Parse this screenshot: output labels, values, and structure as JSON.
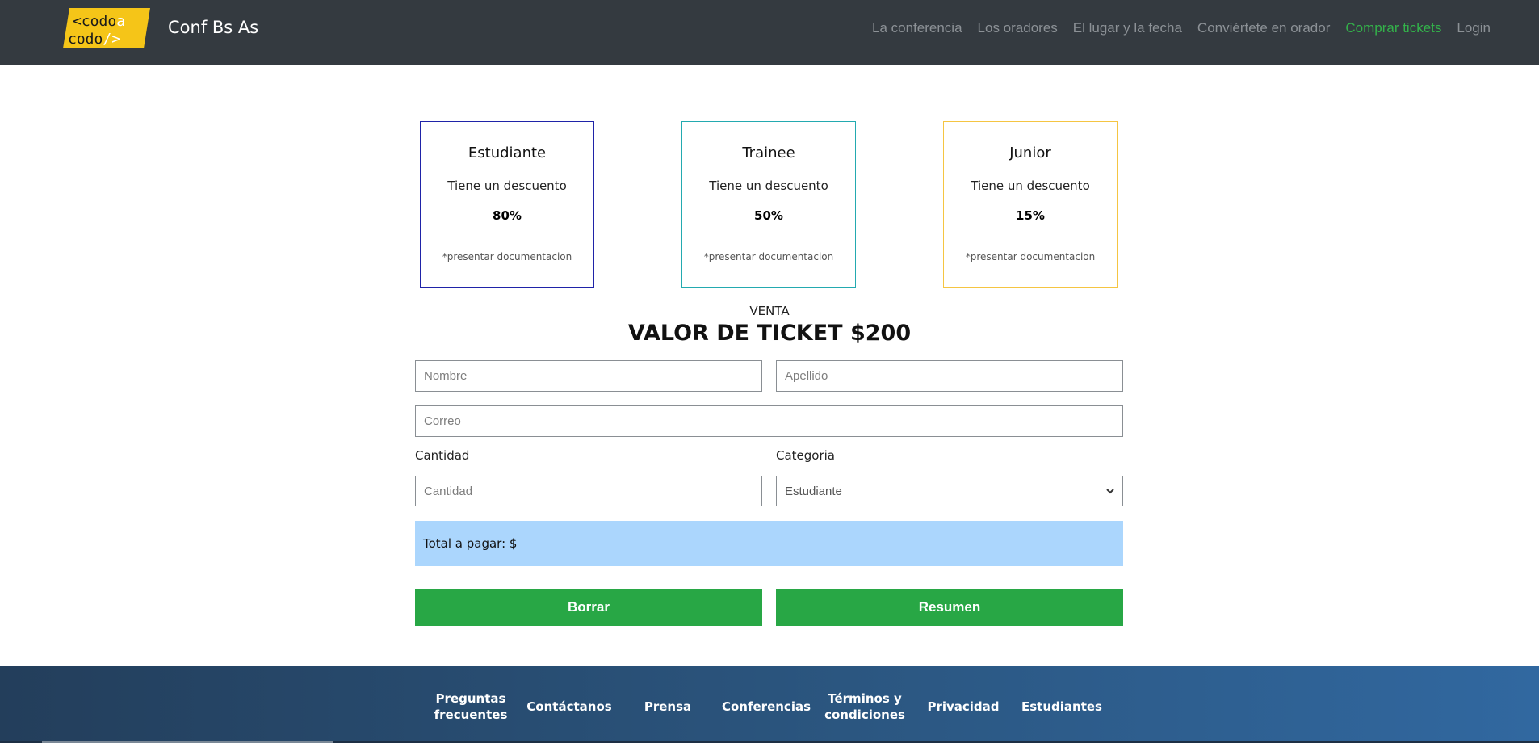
{
  "header": {
    "logo": {
      "line1": "<codo",
      "a1": "a",
      "line2": "codo",
      "a2": "/>"
    },
    "brand": "Conf Bs As",
    "nav": [
      {
        "label": "La conferencia"
      },
      {
        "label": "Los oradores"
      },
      {
        "label": "El lugar y la fecha"
      },
      {
        "label": "Conviértete en orador"
      },
      {
        "label": "Comprar tickets",
        "active": true
      },
      {
        "label": "Login"
      }
    ]
  },
  "cards": [
    {
      "title": "Estudiante",
      "desc": "Tiene un descuento",
      "pct": "80%",
      "note": "*presentar documentacion",
      "border": "#1f23a8"
    },
    {
      "title": "Trainee",
      "desc": "Tiene un descuento",
      "pct": "50%",
      "note": "*presentar documentacion",
      "border": "#23aab0"
    },
    {
      "title": "Junior",
      "desc": "Tiene un descuento",
      "pct": "15%",
      "note": "*presentar documentacion",
      "border": "#f5c542"
    }
  ],
  "ticket": {
    "venta": "VENTA",
    "valor": "VALOR DE TICKET $200"
  },
  "form": {
    "nombre_placeholder": "Nombre",
    "apellido_placeholder": "Apellido",
    "correo_placeholder": "Correo",
    "cantidad_label": "Cantidad",
    "cantidad_placeholder": "Cantidad",
    "categoria_label": "Categoria",
    "categoria_selected": "Estudiante",
    "total_label": "Total a pagar: $",
    "borrar_label": "Borrar",
    "resumen_label": "Resumen"
  },
  "footer": {
    "links": [
      {
        "line1": "Preguntas",
        "line2": "frecuentes"
      },
      {
        "line1": "Contáctanos",
        "line2": ""
      },
      {
        "line1": "Prensa",
        "line2": ""
      },
      {
        "line1": "Conferencias",
        "line2": ""
      },
      {
        "line1": "Términos y",
        "line2": "condiciones"
      },
      {
        "line1": "Privacidad",
        "line2": ""
      },
      {
        "line1": "Estudiantes",
        "line2": ""
      }
    ]
  },
  "colors": {
    "navbar": "#343a40",
    "active_link": "#33b24a",
    "logo_yellow": "#f5c518",
    "button_green": "#28a745",
    "total_bg": "#abd6fd"
  }
}
